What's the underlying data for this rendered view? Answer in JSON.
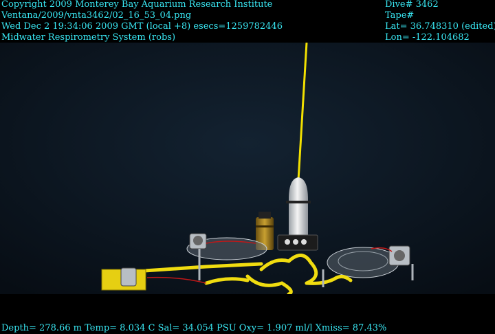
{
  "overlay": {
    "top_left": [
      "Copyright 2009 Monterey Bay Aquarium Research Institute",
      "Ventana/2009/vnta3462/02_16_53_04.png",
      "Wed Dec  2 19:34:06 2009 GMT (local +8)  esecs=1259782446",
      "Midwater Respirometry System (robs)"
    ],
    "top_right": [
      "Dive# 3462",
      "Tape#",
      "Lat= 36.748310 (edited)",
      "Lon= -122.104682"
    ],
    "bottom": "Depth= 278.66 m  Temp= 8.034 C  Sal= 34.054 PSU  Oxy= 1.907 ml/l  Xmiss= 87.43%"
  },
  "scene": {
    "water_color": "#0b1622",
    "tether_color": "#f2e000",
    "frame_color": "#f0dc10",
    "float_color": "#e8e8e8"
  }
}
